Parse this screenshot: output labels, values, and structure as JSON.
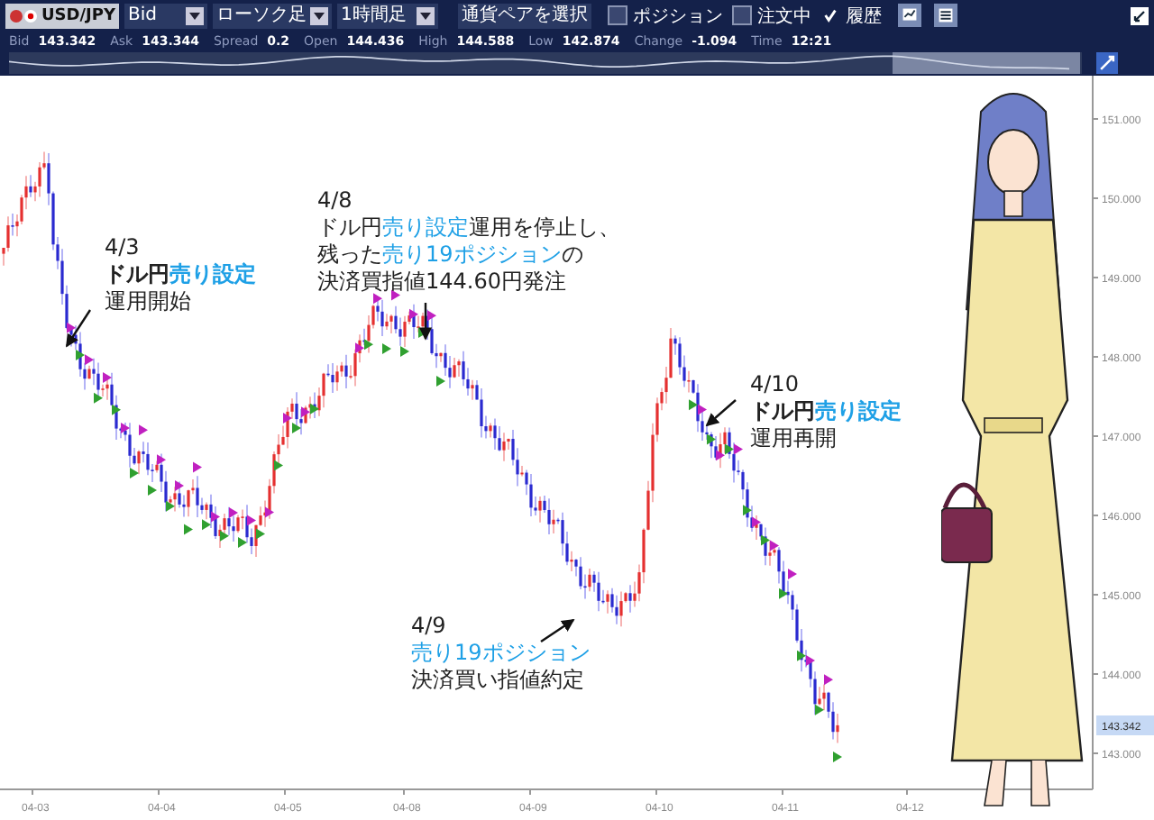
{
  "toolbar": {
    "symbol": "USD/JPY",
    "price_type": "Bid",
    "chart_type": "ローソク足",
    "timeframe": "1時間足",
    "pair_button": "通貨ペアを選択",
    "toggles": [
      {
        "label": "ポジション",
        "checked": false
      },
      {
        "label": "注文中",
        "checked": false
      },
      {
        "label": "履歴",
        "checked": true
      }
    ]
  },
  "quote": [
    {
      "label": "Bid",
      "value": "143.342"
    },
    {
      "label": "Ask",
      "value": "143.344"
    },
    {
      "label": "Spread",
      "value": "0.2"
    },
    {
      "label": "Open",
      "value": "144.436"
    },
    {
      "label": "High",
      "value": "144.588"
    },
    {
      "label": "Low",
      "value": "142.874"
    },
    {
      "label": "Change",
      "value": "-1.094"
    },
    {
      "label": "Time",
      "value": "12:21"
    }
  ],
  "chart": {
    "y_ticks": [
      "151.000",
      "150.000",
      "149.000",
      "148.000",
      "147.000",
      "146.000",
      "145.000",
      "144.000",
      "143.000"
    ],
    "x_ticks": [
      "04-03",
      "04-04",
      "04-05",
      "04-08",
      "04-09",
      "04-10",
      "04-11",
      "04-12"
    ],
    "current_price": "143.342",
    "annotations": [
      {
        "date": "4/3",
        "lines": [
          [
            {
              "text": "**ドル円**",
              "kind": "plain"
            },
            {
              "text": "**売り設定**",
              "kind": "accent"
            }
          ],
          [
            {
              "text": "運用開始",
              "kind": "plain"
            }
          ]
        ]
      },
      {
        "date": "4/8",
        "lines": [
          [
            {
              "text": "ドル円",
              "kind": "plain"
            },
            {
              "text": "売り設定",
              "kind": "accent"
            },
            {
              "text": "運用を停止し、",
              "kind": "plain"
            }
          ],
          [
            {
              "text": "残った",
              "kind": "plain"
            },
            {
              "text": "売り19ポジション",
              "kind": "accent"
            },
            {
              "text": "の",
              "kind": "plain"
            }
          ],
          [
            {
              "text": "決済買指値144.60円発注",
              "kind": "plain"
            }
          ]
        ]
      },
      {
        "date": "4/9",
        "lines": [
          [
            {
              "text": "売り19ポジション",
              "kind": "accent"
            }
          ],
          [
            {
              "text": "決済買い指値約定",
              "kind": "plain"
            }
          ]
        ]
      },
      {
        "date": "4/10",
        "lines": [
          [
            {
              "text": "**ドル円**",
              "kind": "plain"
            },
            {
              "text": "**売り設定**",
              "kind": "accent"
            }
          ],
          [
            {
              "text": "運用再開",
              "kind": "plain"
            }
          ]
        ]
      }
    ]
  }
}
